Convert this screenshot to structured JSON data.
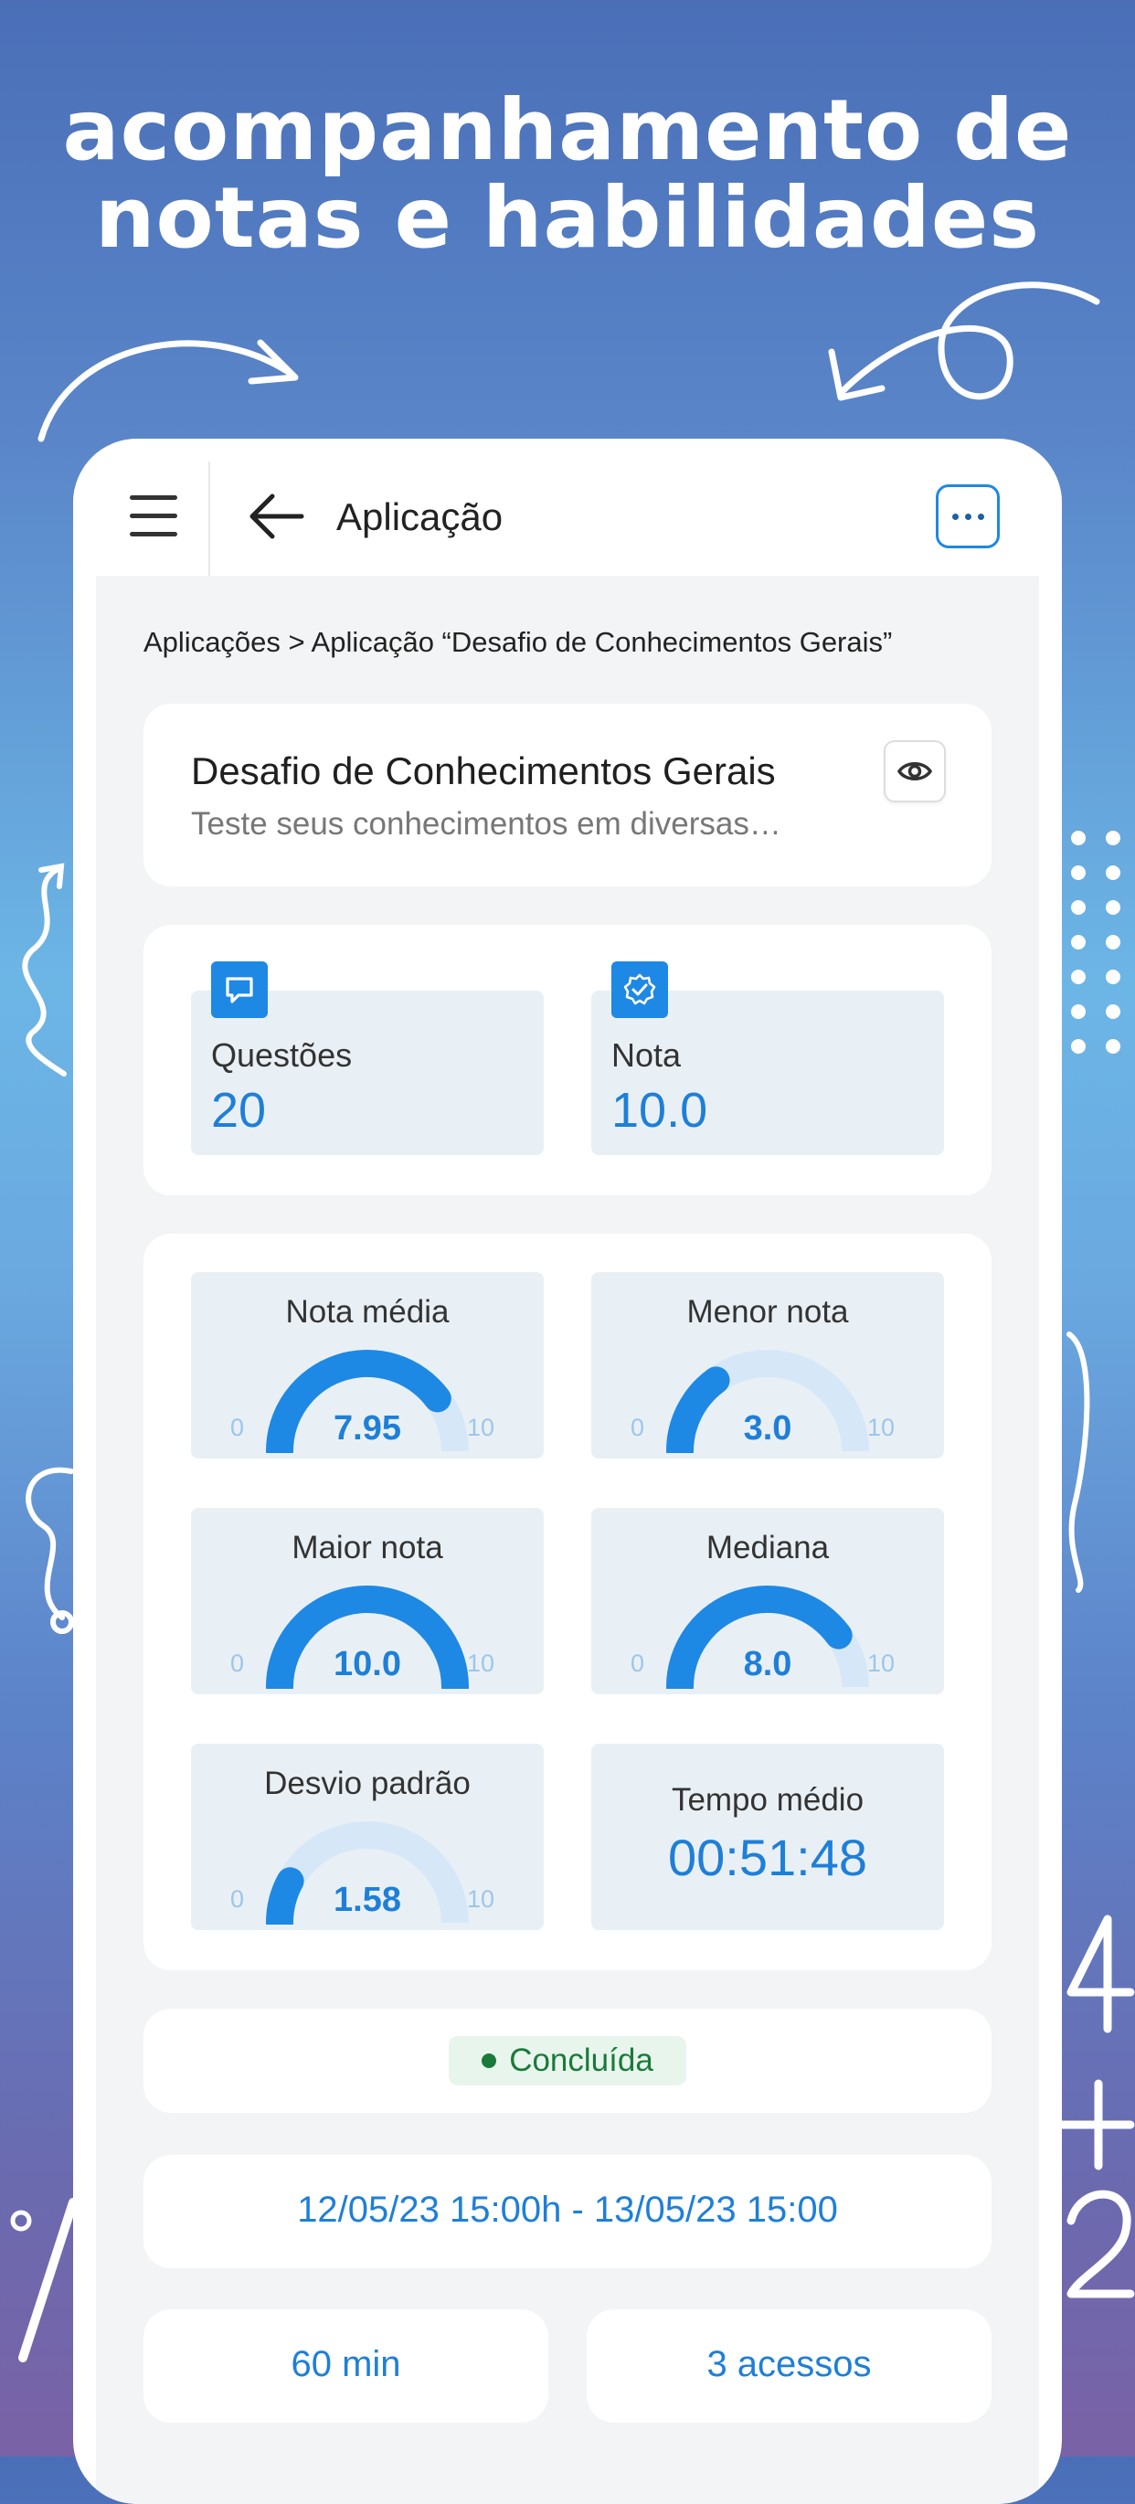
{
  "headline": {
    "line1": "acompanhamento de",
    "line2": "notas e habilidades"
  },
  "appbar": {
    "title": "Aplicação"
  },
  "breadcrumb": "Aplicações > Aplicação “Desafio de Conhecimentos Gerais”",
  "application": {
    "title": "Desafio de Conhecimentos Gerais",
    "subtitle": "Teste seus conhecimentos em diversas…"
  },
  "stats": {
    "questions": {
      "label": "Questões",
      "value": "20"
    },
    "grade": {
      "label": "Nota",
      "value": "10.0"
    }
  },
  "gauges": {
    "average": {
      "label": "Nota média",
      "value": "7.95",
      "fraction": 0.795,
      "min": "0",
      "max": "10"
    },
    "lowest": {
      "label": "Menor nota",
      "value": "3.0",
      "fraction": 0.3,
      "min": "0",
      "max": "10"
    },
    "highest": {
      "label": "Maior nota",
      "value": "10.0",
      "fraction": 1.0,
      "min": "0",
      "max": "10"
    },
    "median": {
      "label": "Mediana",
      "value": "8.0",
      "fraction": 0.8,
      "min": "0",
      "max": "10"
    },
    "stddev": {
      "label": "Desvio padrão",
      "value": "1.58",
      "fraction": 0.158,
      "min": "0",
      "max": "10"
    }
  },
  "average_time": {
    "label": "Tempo médio",
    "value": "00:51:48"
  },
  "status": {
    "label": "Concluída",
    "color": "#1a7a3a"
  },
  "period": "12/05/23 15:00h - 13/05/23 15:00",
  "duration": "60 min",
  "accesses": "3 acessos",
  "colors": {
    "accent": "#1e88e5",
    "accent_text": "#1e7fd8",
    "gauge_track": "#d6e8f8"
  }
}
